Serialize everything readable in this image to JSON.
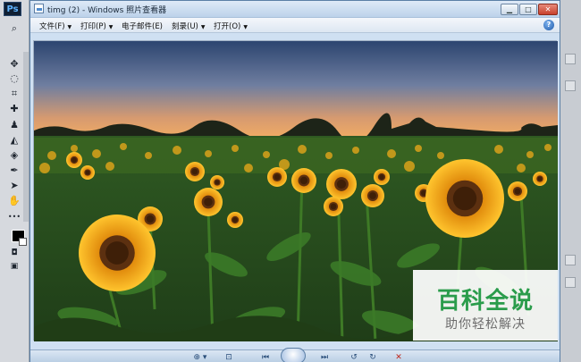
{
  "photoshop": {
    "logo": "Ps",
    "tools": [
      {
        "name": "search-icon",
        "glyph": "⌕"
      },
      {
        "name": "move-tool-icon",
        "glyph": "✥"
      },
      {
        "name": "lasso-tool-icon",
        "glyph": "◌"
      },
      {
        "name": "crop-tool-icon",
        "glyph": "⌗"
      },
      {
        "name": "healing-brush-icon",
        "glyph": "✚"
      },
      {
        "name": "stamp-tool-icon",
        "glyph": "♟"
      },
      {
        "name": "eraser-tool-icon",
        "glyph": "◭"
      },
      {
        "name": "blur-tool-icon",
        "glyph": "◈"
      },
      {
        "name": "pen-tool-icon",
        "glyph": "✒"
      },
      {
        "name": "path-select-icon",
        "glyph": "➤"
      },
      {
        "name": "hand-tool-icon",
        "glyph": "✋"
      },
      {
        "name": "more-tools-icon",
        "glyph": "•••"
      }
    ]
  },
  "viewer": {
    "title": "timg (2) - Windows 照片查看器",
    "window_buttons": {
      "minimize": "▁",
      "maximize": "□",
      "close": "✕"
    },
    "menus": [
      {
        "label": "文件(F)"
      },
      {
        "label": "打印(P)"
      },
      {
        "label": "电子邮件(E)"
      },
      {
        "label": "刻录(U)"
      },
      {
        "label": "打开(O)"
      }
    ],
    "help_glyph": "?",
    "nav": {
      "zoom": "⊕ ▾",
      "fit": "⊡",
      "prev": "⏮",
      "next": "⏭",
      "rotate_ccw": "↺",
      "rotate_cw": "↻",
      "delete": "✕"
    }
  },
  "watermark": {
    "title": "百科全说",
    "subtitle": "助你轻松解决"
  },
  "colors": {
    "sky_top": "#2f4a74",
    "sky_horizon": "#f0a86a",
    "sunflower_petal": "#f6b21a",
    "sunflower_center": "#6b3a12",
    "leaf": "#3d7d2a",
    "watermark_green": "#2a9c4b"
  }
}
